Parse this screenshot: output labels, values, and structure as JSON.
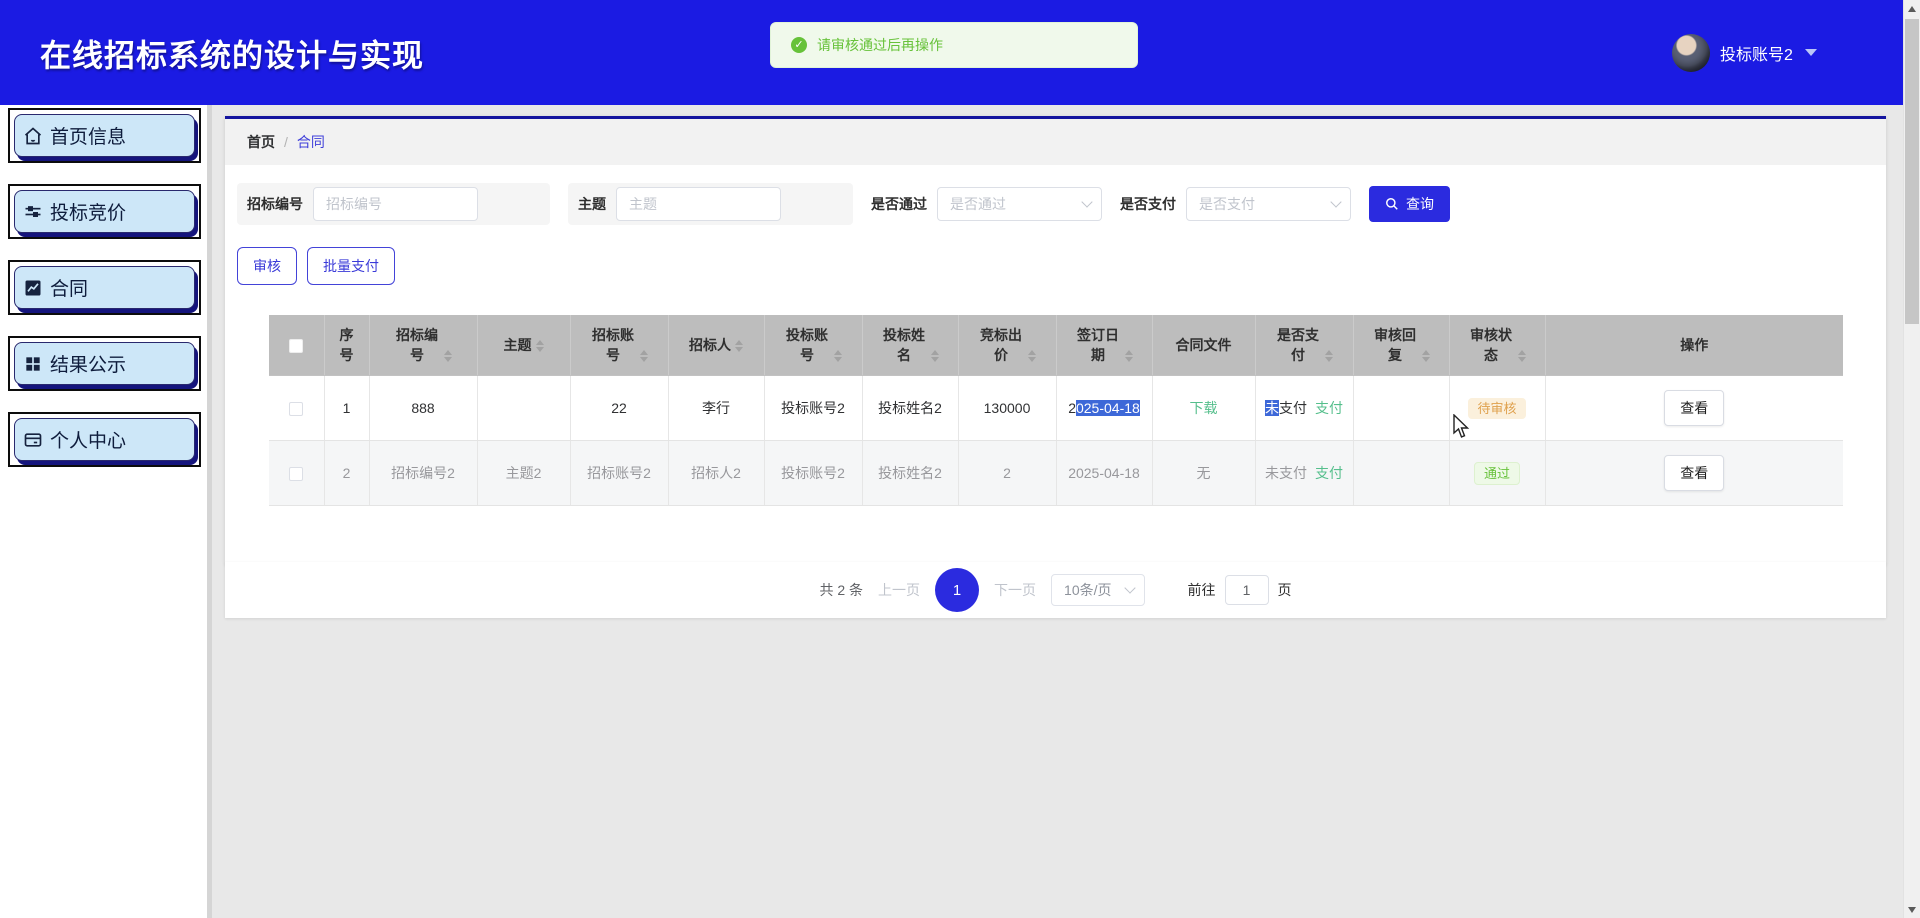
{
  "header": {
    "title": "在线招标系统的设计与实现",
    "toast": {
      "text": "请审核通过后再操作",
      "icon": "check-circle-icon"
    },
    "user": {
      "name": "投标账号2",
      "icon": "caret-down-icon"
    }
  },
  "sidebar": {
    "items": [
      {
        "icon": "home-icon",
        "label": "首页信息"
      },
      {
        "icon": "sliders-icon",
        "label": "投标竞价"
      },
      {
        "icon": "chart-icon",
        "label": "合同"
      },
      {
        "icon": "grid-icon",
        "label": "结果公示"
      },
      {
        "icon": "card-icon",
        "label": "个人中心"
      }
    ]
  },
  "breadcrumb": {
    "home": "首页",
    "separator": "/",
    "current": "合同"
  },
  "filters": {
    "groups": [
      {
        "label": "招标编号",
        "placeholder": "招标编号",
        "type": "input"
      },
      {
        "label": "主题",
        "placeholder": "主题",
        "type": "input"
      },
      {
        "label": "是否通过",
        "placeholder": "是否通过",
        "type": "select"
      },
      {
        "label": "是否支付",
        "placeholder": "是否支付",
        "type": "select"
      }
    ],
    "search_label": "查询",
    "search_icon": "magnifier-icon"
  },
  "actions": {
    "audit": "审核",
    "batch_pay": "批量支付"
  },
  "table": {
    "columns": [
      {
        "label": ""
      },
      {
        "label": "序号"
      },
      {
        "label": "招标编号"
      },
      {
        "label": "主题"
      },
      {
        "label": "招标账号"
      },
      {
        "label": "招标人"
      },
      {
        "label": "投标账号"
      },
      {
        "label": "投标姓名"
      },
      {
        "label": "竞标出价"
      },
      {
        "label": "签订日期"
      },
      {
        "label": "合同文件"
      },
      {
        "label": "是否支付"
      },
      {
        "label": "审核回复"
      },
      {
        "label": "审核状态"
      },
      {
        "label": "操作"
      }
    ],
    "rows": [
      {
        "seq": "1",
        "bid_no": "888",
        "topic": "",
        "bid_account": "22",
        "bidder": "李行",
        "tender_account": "投标账号2",
        "tender_name": "投标姓名2",
        "price": "130000",
        "date_prefix": "2",
        "date_selected": "025-04-18",
        "file_link": "下载",
        "pay_selected": "未",
        "pay_rest": "支付",
        "pay_link": "支付",
        "reply": "",
        "status": "待审核",
        "action": "查看"
      },
      {
        "seq": "2",
        "bid_no": "招标编号2",
        "topic": "主题2",
        "bid_account": "招标账号2",
        "bidder": "招标人2",
        "tender_account": "投标账号2",
        "tender_name": "投标姓名2",
        "price": "2",
        "date": "2025-04-18",
        "file_text": "无",
        "pay_text": "未支付",
        "pay_link": "支付",
        "reply": "",
        "status": "通过",
        "action": "查看"
      }
    ]
  },
  "pagination": {
    "total": "共 2 条",
    "prev": "上一页",
    "current_page": "1",
    "next": "下一页",
    "page_size": "10条/页",
    "goto_prefix": "前往",
    "goto_value": "1",
    "goto_suffix": "页"
  },
  "colors": {
    "header_blue": "#1b1be3",
    "accent_blue": "#2b2bdf",
    "divider_navy": "#14149e",
    "selection_blue": "#3d68d8",
    "success_green": "#67c23a",
    "link_green": "#55bf8c",
    "warning_orange": "#dfa14e",
    "sidebar_item_blue": "#cde7f8",
    "table_header_gray": "#bdbdbd"
  }
}
